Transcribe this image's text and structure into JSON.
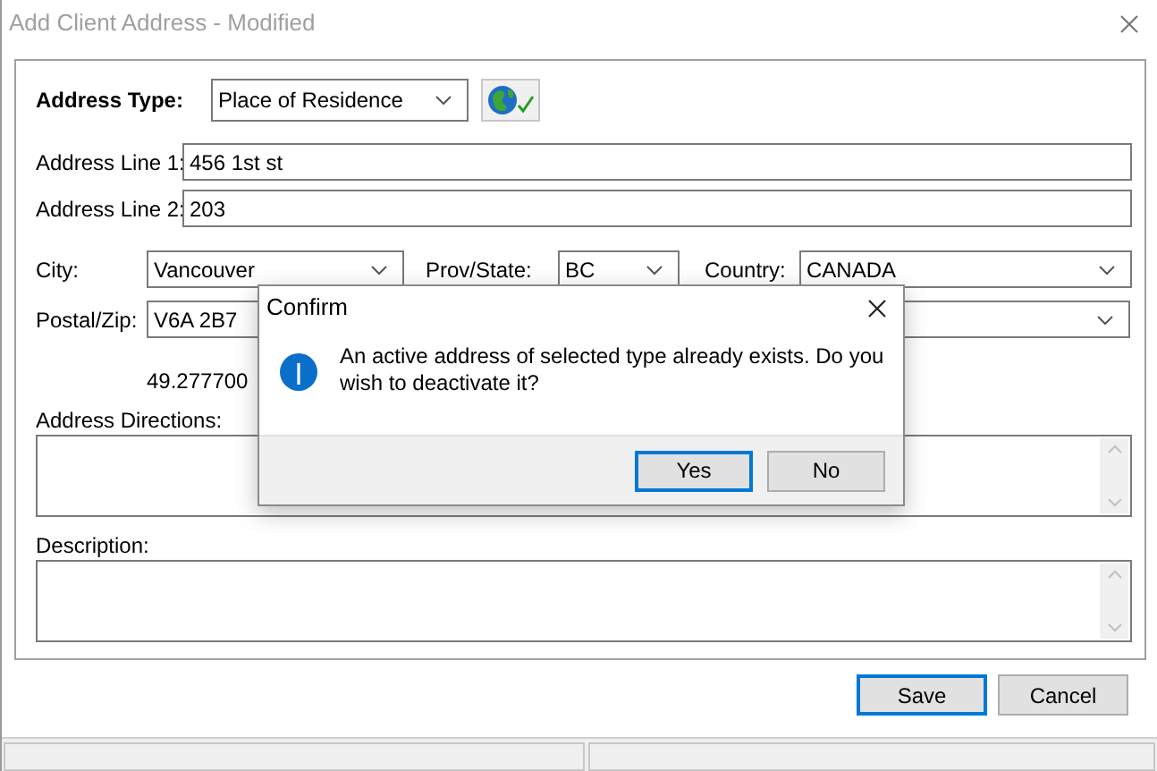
{
  "window": {
    "title": "Add Client Address - Modified"
  },
  "form": {
    "address_type": {
      "label": "Address Type:",
      "value": "Place of Residence"
    },
    "address_line_1": {
      "label": "Address Line 1:",
      "value": "456 1st st"
    },
    "address_line_2": {
      "label": "Address Line 2:",
      "value": "203"
    },
    "city": {
      "label": "City:",
      "value": "Vancouver"
    },
    "prov_state": {
      "label": "Prov/State:",
      "value": "BC"
    },
    "country": {
      "label": "Country:",
      "value": "CANADA"
    },
    "postal_zip": {
      "label": "Postal/Zip:",
      "value": "V6A 2B7"
    },
    "coordinate": "49.277700",
    "address_directions": {
      "label": "Address Directions:"
    },
    "description": {
      "label": "Description:"
    }
  },
  "buttons": [
    {
      "label": "Save",
      "default": true
    },
    {
      "label": "Cancel",
      "default": false
    }
  ],
  "dialog": {
    "title": "Confirm",
    "message": "An active address of selected type already exists. Do you wish to deactivate it?",
    "buttons": [
      {
        "label": "Yes",
        "default": true
      },
      {
        "label": "No",
        "default": false
      }
    ]
  }
}
